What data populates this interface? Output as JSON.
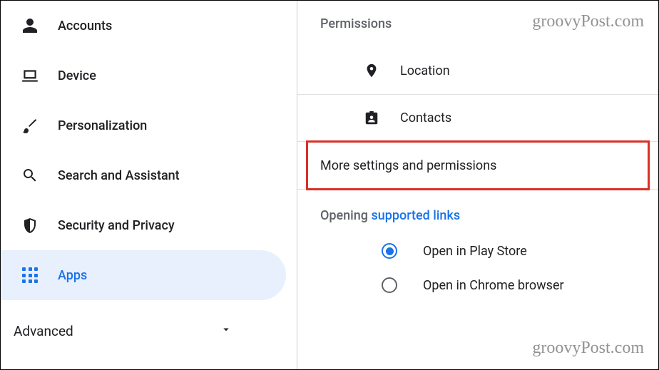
{
  "sidebar": {
    "items": [
      {
        "label": "Accounts"
      },
      {
        "label": "Device"
      },
      {
        "label": "Personalization"
      },
      {
        "label": "Search and Assistant"
      },
      {
        "label": "Security and Privacy"
      },
      {
        "label": "Apps"
      }
    ],
    "advanced_label": "Advanced"
  },
  "main": {
    "permissions_header": "Permissions",
    "permissions": [
      {
        "label": "Location"
      },
      {
        "label": "Contacts"
      }
    ],
    "more_label": "More settings and permissions",
    "opening_prefix": "Opening ",
    "opening_link": "supported links",
    "radio_options": [
      {
        "label": "Open in Play Store",
        "selected": true
      },
      {
        "label": "Open in Chrome browser",
        "selected": false
      }
    ]
  },
  "watermark": "groovyPost.com"
}
